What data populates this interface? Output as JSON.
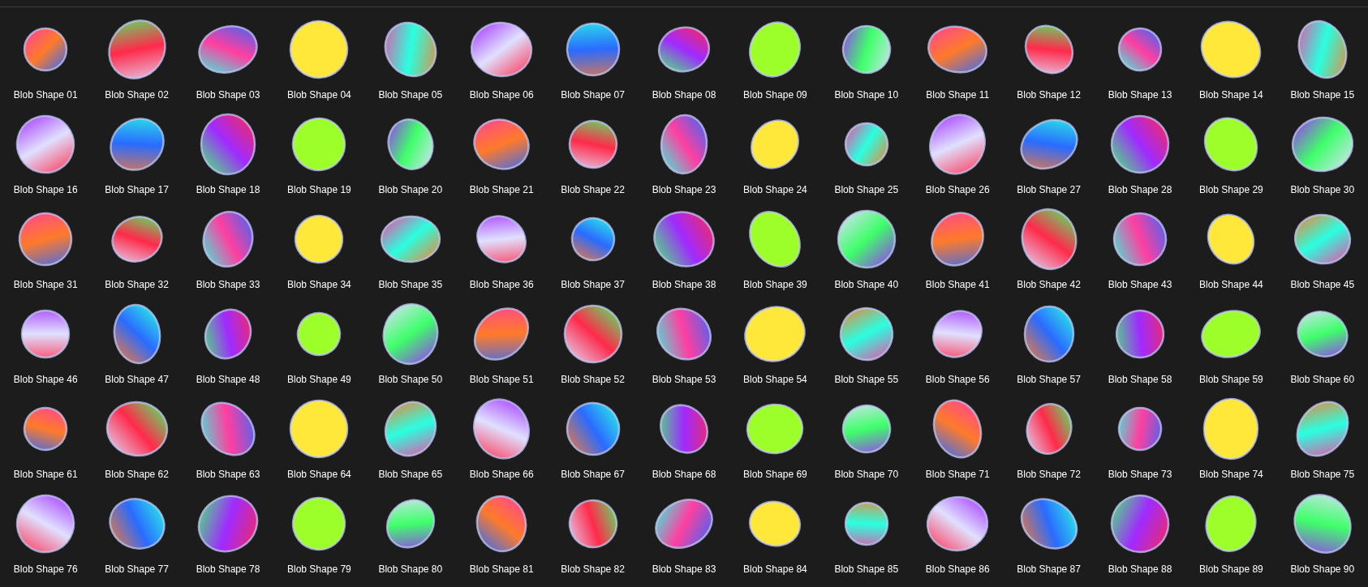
{
  "files": [
    "Blob Shape 01",
    "Blob Shape 02",
    "Blob Shape 03",
    "Blob Shape 04",
    "Blob Shape 05",
    "Blob Shape 06",
    "Blob Shape 07",
    "Blob Shape 08",
    "Blob Shape 09",
    "Blob Shape 10",
    "Blob Shape 11",
    "Blob Shape 12",
    "Blob Shape 13",
    "Blob Shape 14",
    "Blob Shape 15",
    "Blob Shape 16",
    "Blob Shape 17",
    "Blob Shape 18",
    "Blob Shape 19",
    "Blob Shape 20",
    "Blob Shape 21",
    "Blob Shape 22",
    "Blob Shape 23",
    "Blob Shape 24",
    "Blob Shape 25",
    "Blob Shape 26",
    "Blob Shape 27",
    "Blob Shape 28",
    "Blob Shape 29",
    "Blob Shape 30",
    "Blob Shape 31",
    "Blob Shape 32",
    "Blob Shape 33",
    "Blob Shape 34",
    "Blob Shape 35",
    "Blob Shape 36",
    "Blob Shape 37",
    "Blob Shape 38",
    "Blob Shape 39",
    "Blob Shape 40",
    "Blob Shape 41",
    "Blob Shape 42",
    "Blob Shape 43",
    "Blob Shape 44",
    "Blob Shape 45",
    "Blob Shape 46",
    "Blob Shape 47",
    "Blob Shape 48",
    "Blob Shape 49",
    "Blob Shape 50",
    "Blob Shape 51",
    "Blob Shape 52",
    "Blob Shape 53",
    "Blob Shape 54",
    "Blob Shape 55",
    "Blob Shape 56",
    "Blob Shape 57",
    "Blob Shape 58",
    "Blob Shape 59",
    "Blob Shape 60",
    "Blob Shape 61",
    "Blob Shape 62",
    "Blob Shape 63",
    "Blob Shape 64",
    "Blob Shape 65",
    "Blob Shape 66",
    "Blob Shape 67",
    "Blob Shape 68",
    "Blob Shape 69",
    "Blob Shape 70",
    "Blob Shape 71",
    "Blob Shape 72",
    "Blob Shape 73",
    "Blob Shape 74",
    "Blob Shape 75",
    "Blob Shape 76",
    "Blob Shape 77",
    "Blob Shape 78",
    "Blob Shape 79",
    "Blob Shape 80",
    "Blob Shape 81",
    "Blob Shape 82",
    "Blob Shape 83",
    "Blob Shape 84",
    "Blob Shape 85",
    "Blob Shape 86",
    "Blob Shape 87",
    "Blob Shape 88",
    "Blob Shape 89",
    "Blob Shape 90"
  ]
}
